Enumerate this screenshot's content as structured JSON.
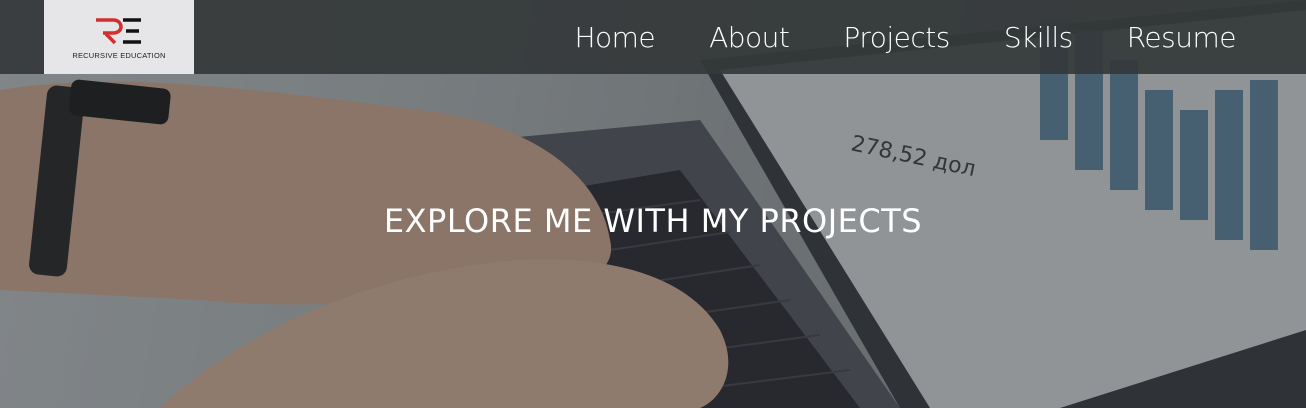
{
  "logo": {
    "text": "RECURSIVE EDUCATION",
    "mark": "RE",
    "mark_colors": [
      "#d32f2f",
      "#111111"
    ]
  },
  "nav": {
    "items": [
      {
        "label": "Home"
      },
      {
        "label": "About"
      },
      {
        "label": "Projects"
      },
      {
        "label": "Skills"
      },
      {
        "label": "Resume"
      }
    ]
  },
  "hero": {
    "title": "EXPLORE ME WITH MY PROJECTS",
    "screen_text": [
      "278,52 дол"
    ]
  },
  "colors": {
    "navbar": "#34383a",
    "text": "#ffffff",
    "logo_bg": "#e6e6e8"
  }
}
